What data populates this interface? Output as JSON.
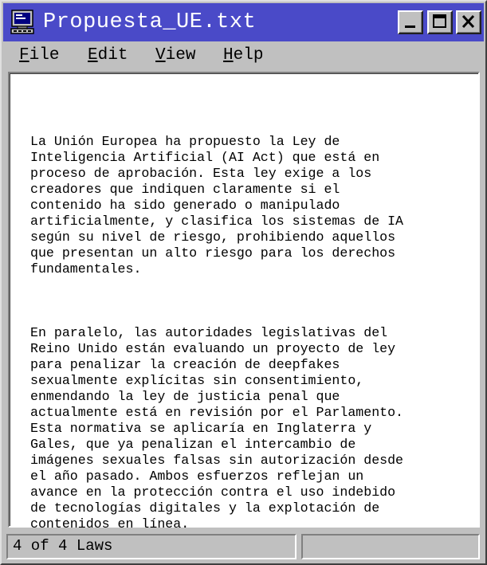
{
  "window": {
    "title": "Propuesta_UE.txt",
    "title_bar_color": "#4a4ac8",
    "icon": "computer-icon"
  },
  "title_buttons": {
    "minimize": "minimize-icon",
    "maximize": "maximize-icon",
    "close": "close-icon"
  },
  "menu": [
    {
      "accel": "F",
      "rest": "ile"
    },
    {
      "accel": "E",
      "rest": "dit"
    },
    {
      "accel": "V",
      "rest": "iew"
    },
    {
      "accel": "H",
      "rest": "elp"
    }
  ],
  "document": {
    "paragraphs": [
      "La Unión Europea ha propuesto la Ley de\nInteligencia Artificial (AI Act) que está en\nproceso de aprobación. Esta ley exige a los\ncreadores que indiquen claramente si el\ncontenido ha sido generado o manipulado\nartificialmente, y clasifica los sistemas de IA\nsegún su nivel de riesgo, prohibiendo aquellos\nque presentan un alto riesgo para los derechos\nfundamentales.",
      "En paralelo, las autoridades legislativas del\nReino Unido están evaluando un proyecto de ley\npara penalizar la creación de deepfakes\nsexualmente explícitas sin consentimiento,\nenmendando la ley de justicia penal que\nactualmente está en revisión por el Parlamento.\nEsta normativa se aplicaría en Inglaterra y\nGales, que ya penalizan el intercambio de\nimágenes sexuales falsas sin autorización desde\nel año pasado. Ambos esfuerzos reflejan un\navance en la protección contra el uso indebido\nde tecnologías digitales y la explotación de\ncontenidos en línea."
    ]
  },
  "status": {
    "left": "4 of 4 Laws",
    "right": ""
  }
}
